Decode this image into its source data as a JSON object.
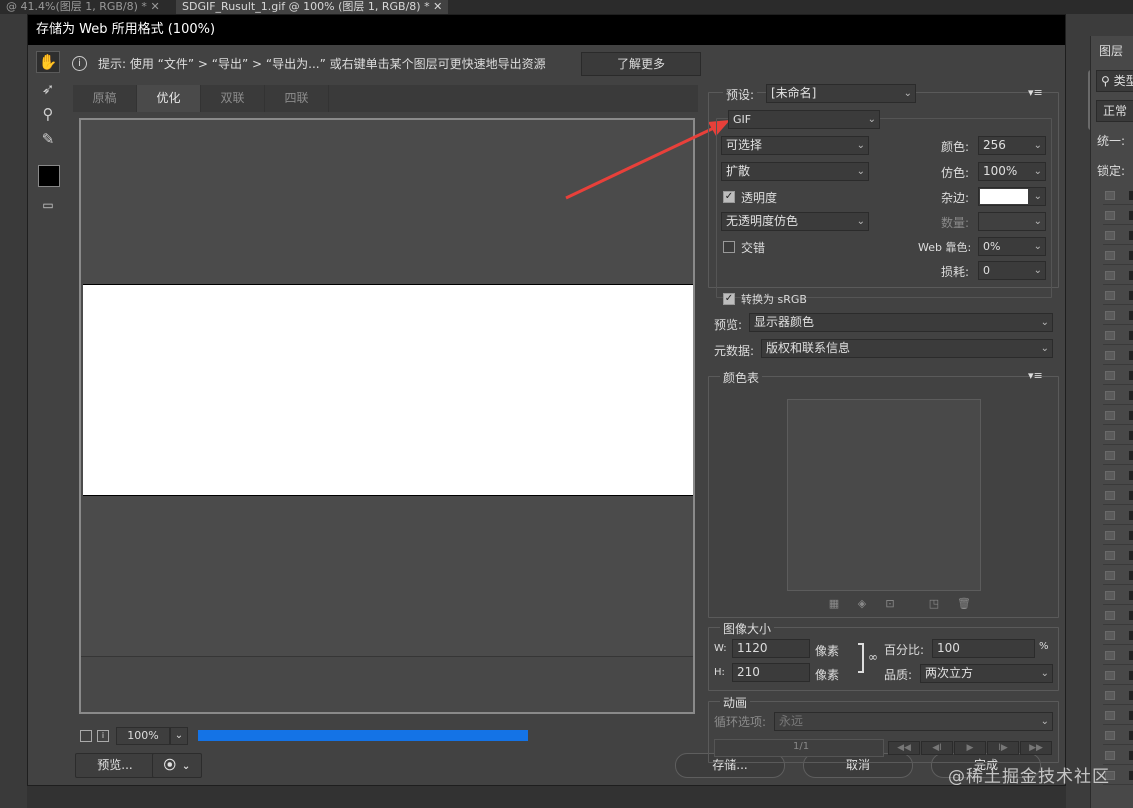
{
  "ps": {
    "tab1": "@ 41.4%(图层 1, RGB/8) *",
    "tab1_close": "✕",
    "tab2": "SDGIF_Rusult_1.gif @ 100% (图层 1, RGB/8) *",
    "tab2_close": "✕",
    "layers_title": "图层",
    "layers_search": "类型",
    "layers_mode": "正常",
    "layers_unify": "统一:",
    "layers_lock": "锁定:"
  },
  "dialog": {
    "title": "存储为 Web 所用格式 (100%)",
    "hint_icon": "i",
    "hint": "提示: 使用 “文件” > “导出” > “导出为...” 或右键单击某个图层可更快速地导出资源",
    "learn_more": "了解更多",
    "view_tabs": [
      "原稿",
      "优化",
      "双联",
      "四联"
    ],
    "zoom": "100%",
    "progress_percent": 100,
    "preview_btn": "预览...",
    "save_btn": "存储...",
    "cancel_btn": "取消",
    "done_btn": "完成"
  },
  "settings": {
    "preset_label": "预设:",
    "preset_value": "[未命名]",
    "format": "GIF",
    "reduction": "可选择",
    "dither_algo": "扩散",
    "transparency_label": "透明度",
    "transparency_checked": true,
    "trans_dither": "无透明度仿色",
    "interlaced_label": "交错",
    "interlaced_checked": false,
    "colors_label": "颜色:",
    "colors_value": "256",
    "dither_label": "仿色:",
    "dither_value": "100%",
    "matte_label": "杂边:",
    "amount_label": "数量:",
    "web_snap_label": "Web 靠色:",
    "web_snap_value": "0%",
    "lossy_label": "损耗:",
    "lossy_value": "0",
    "convert_srgb_label": "转换为 sRGB",
    "convert_srgb_checked": true,
    "preview_label": "预览:",
    "preview_value": "显示器颜色",
    "metadata_label": "元数据:",
    "metadata_value": "版权和联系信息"
  },
  "color_table": {
    "title": "颜色表"
  },
  "image_size": {
    "title": "图像大小",
    "w_label": "W:",
    "w_value": "1120",
    "h_label": "H:",
    "h_value": "210",
    "unit": "像素",
    "percent_label": "百分比:",
    "percent_value": "100",
    "percent_unit": "%",
    "quality_label": "品质:",
    "quality_value": "两次立方"
  },
  "animation": {
    "title": "动画",
    "loop_label": "循环选项:",
    "loop_value": "永远",
    "frame": "1/1"
  },
  "watermark": "@稀土掘金技术社区",
  "colors": {
    "accent": "#1473e6",
    "arrow": "#e8403a"
  }
}
